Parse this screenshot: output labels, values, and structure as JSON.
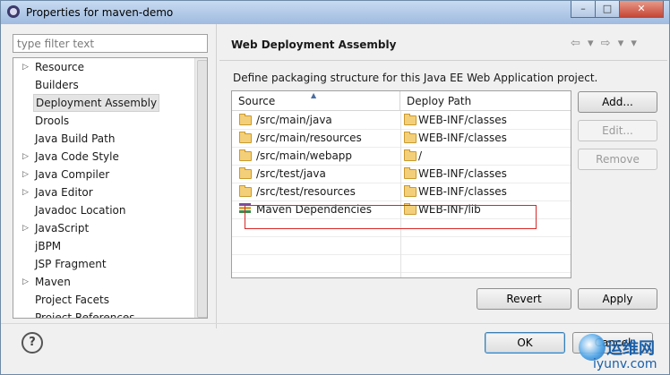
{
  "window": {
    "title": "Properties for maven-demo",
    "controls": {
      "minimize": "–",
      "maximize": "□",
      "close": "✕"
    }
  },
  "sidebar": {
    "filter_placeholder": "type filter text",
    "items": [
      {
        "label": "Resource",
        "expandable": true
      },
      {
        "label": "Builders",
        "expandable": false
      },
      {
        "label": "Deployment Assembly",
        "expandable": false,
        "selected": true
      },
      {
        "label": "Drools",
        "expandable": false
      },
      {
        "label": "Java Build Path",
        "expandable": false
      },
      {
        "label": "Java Code Style",
        "expandable": true
      },
      {
        "label": "Java Compiler",
        "expandable": true
      },
      {
        "label": "Java Editor",
        "expandable": true
      },
      {
        "label": "Javadoc Location",
        "expandable": false
      },
      {
        "label": "JavaScript",
        "expandable": true
      },
      {
        "label": "jBPM",
        "expandable": false
      },
      {
        "label": "JSP Fragment",
        "expandable": false
      },
      {
        "label": "Maven",
        "expandable": true
      },
      {
        "label": "Project Facets",
        "expandable": false
      },
      {
        "label": "Project References",
        "expandable": false
      }
    ]
  },
  "panel": {
    "title": "Web Deployment Assembly",
    "nav_arrows": "⇦ ▾ ⇨ ▾ ▾",
    "description": "Define packaging structure for this Java EE Web Application project.",
    "columns": {
      "source": "Source",
      "deploy_path": "Deploy Path"
    },
    "rows": [
      {
        "source": "/src/main/java",
        "deploy": "WEB-INF/classes",
        "icon": "folder-icon"
      },
      {
        "source": "/src/main/resources",
        "deploy": "WEB-INF/classes",
        "icon": "folder-icon"
      },
      {
        "source": "/src/main/webapp",
        "deploy": "/",
        "icon": "folder-icon"
      },
      {
        "source": "/src/test/java",
        "deploy": "WEB-INF/classes",
        "icon": "folder-icon"
      },
      {
        "source": "/src/test/resources",
        "deploy": "WEB-INF/classes",
        "icon": "folder-icon"
      },
      {
        "source": "Maven Dependencies",
        "deploy": "WEB-INF/lib",
        "icon": "library-icon"
      }
    ],
    "buttons": {
      "add": "Add...",
      "edit": "Edit...",
      "remove": "Remove"
    },
    "revert": "Revert",
    "apply": "Apply"
  },
  "footer": {
    "help": "?",
    "ok": "OK",
    "cancel": "Cancel"
  },
  "watermark": {
    "cn": "运维网",
    "url": "iyunv.com"
  },
  "colors": {
    "highlight_box": "#d62828",
    "accent": "#3c7fb1"
  }
}
